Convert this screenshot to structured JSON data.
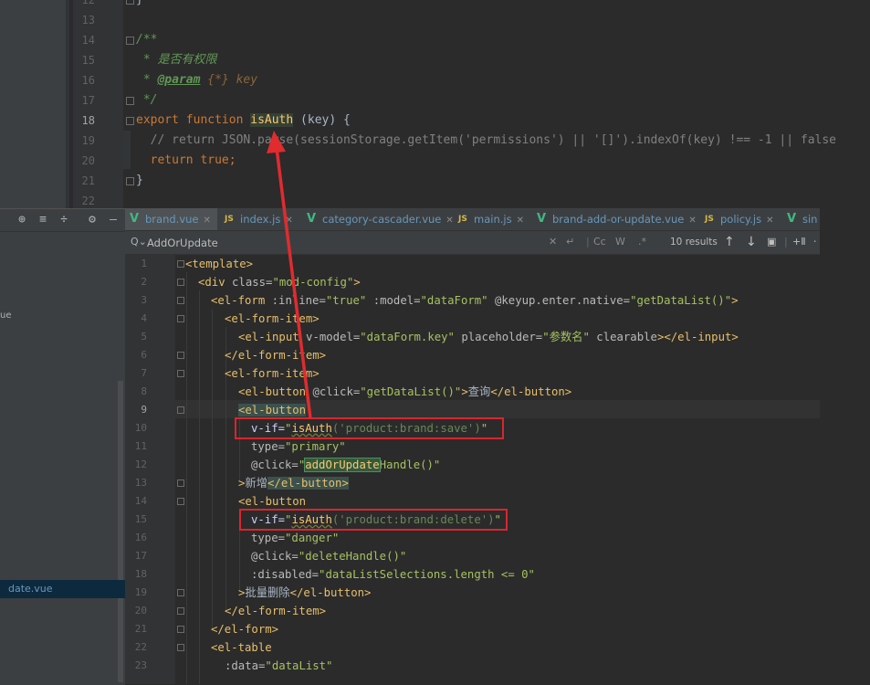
{
  "top_editor": {
    "line_numbers": [
      "12",
      "13",
      "14",
      "15",
      "16",
      "17",
      "18",
      "19",
      "20",
      "21",
      "22"
    ],
    "line12": "}",
    "doc_open": "/**",
    "doc_desc": " * 是否有权限",
    "doc_param_star": " * ",
    "doc_param_tag": "@param",
    "doc_param_type": " {*}",
    "doc_param_name": " key",
    "doc_close": " */",
    "fn_kw_export": "export",
    "fn_kw_function": " function ",
    "fn_name": "isAuth",
    "fn_args": " (key) {",
    "line19": "  // return JSON.parse(sessionStorage.getItem('permissions') || '[]').indexOf(key) !== -1 || false",
    "line20_kw": "  return",
    "line20_rest": " true;",
    "line21": "}"
  },
  "tabs": [
    {
      "label": "brand.vue",
      "icon": "vue-icon",
      "active": true
    },
    {
      "label": "index.js",
      "icon": "js-icon",
      "active": false
    },
    {
      "label": "category-cascader.vue",
      "icon": "vue-icon",
      "active": false
    },
    {
      "label": "main.js",
      "icon": "js-icon",
      "active": false
    },
    {
      "label": "brand-add-or-update.vue",
      "icon": "vue-icon",
      "active": false
    },
    {
      "label": "policy.js",
      "icon": "js-icon",
      "active": false
    },
    {
      "label": "sin",
      "icon": "vue-icon",
      "active": false
    }
  ],
  "search": {
    "value": "AddOrUpdate",
    "results": "10 results",
    "case_btn": "Cc",
    "word_btn": "W",
    "regex_btn": ".*"
  },
  "sidebar": {
    "selected_file": "date.vue",
    "cut_text": "ue"
  },
  "code_line_numbers": [
    "1",
    "2",
    "3",
    "4",
    "5",
    "6",
    "7",
    "8",
    "9",
    "10",
    "11",
    "12",
    "13",
    "14",
    "15",
    "16",
    "17",
    "18",
    "19",
    "20",
    "21",
    "22",
    "23"
  ],
  "code": {
    "l1_tag": "<template>",
    "l2_open": "<div ",
    "l2_attr": "class=",
    "l2_val": "\"mod-config\"",
    "l2_close": ">",
    "l3_open": "<el-form ",
    "l3_a1": ":inline=",
    "l3_v1": "\"true\"",
    "l3_a2": " :model=",
    "l3_v2": "\"dataForm\"",
    "l3_a3": " @keyup.enter.native=",
    "l3_v3": "\"getDataList()\"",
    "l3_close": ">",
    "l4": "<el-form-item>",
    "l5_open": "<el-input ",
    "l5_a1": "v-model=",
    "l5_v1": "\"dataForm.key\"",
    "l5_a2": " placeholder=",
    "l5_v2": "\"参数名\"",
    "l5_a3": " clearable",
    "l5_close": "></el-input>",
    "l6": "</el-form-item>",
    "l7": "<el-form-item>",
    "l8_open": "<el-button ",
    "l8_a1": "@click=",
    "l8_v1": "\"getDataList()\"",
    "l8_gt": ">",
    "l8_txt": "查询",
    "l8_close": "</el-button>",
    "l9": "<el-button",
    "l10_attr": "v-if=",
    "l10_q1": "\"",
    "l10_fn": "isAuth",
    "l10_arg": "('product:brand:save')",
    "l10_q2": "\"",
    "l11_attr": "type=",
    "l11_val": "\"primary\"",
    "l12_attr": "@click=",
    "l12_q": "\"",
    "l12_match": "addOrUpdate",
    "l12_rest": "Handle()\"",
    "l13_gt": ">",
    "l13_txt": "新增",
    "l13_close": "</el-button>",
    "l14": "<el-button",
    "l15_attr": "v-if=",
    "l15_q1": "\"",
    "l15_fn": "isAuth",
    "l15_arg": "('product:brand:delete')",
    "l15_q2": "\"",
    "l16_attr": "type=",
    "l16_val": "\"danger\"",
    "l17_attr": "@click=",
    "l17_val": "\"deleteHandle()\"",
    "l18_attr": ":disabled=",
    "l18_val": "\"dataListSelections.length <= 0\"",
    "l19_gt": ">",
    "l19_txt": "批量删除",
    "l19_close": "</el-button>",
    "l20": "</el-form-item>",
    "l21": "</el-form>",
    "l22": "<el-table",
    "l23_attr": ":data=",
    "l23_val": "\"dataList\""
  },
  "colors": {
    "annotation_red": "#d9262c",
    "editor_bg": "#2b2b2b",
    "vue_green": "#41b883"
  }
}
